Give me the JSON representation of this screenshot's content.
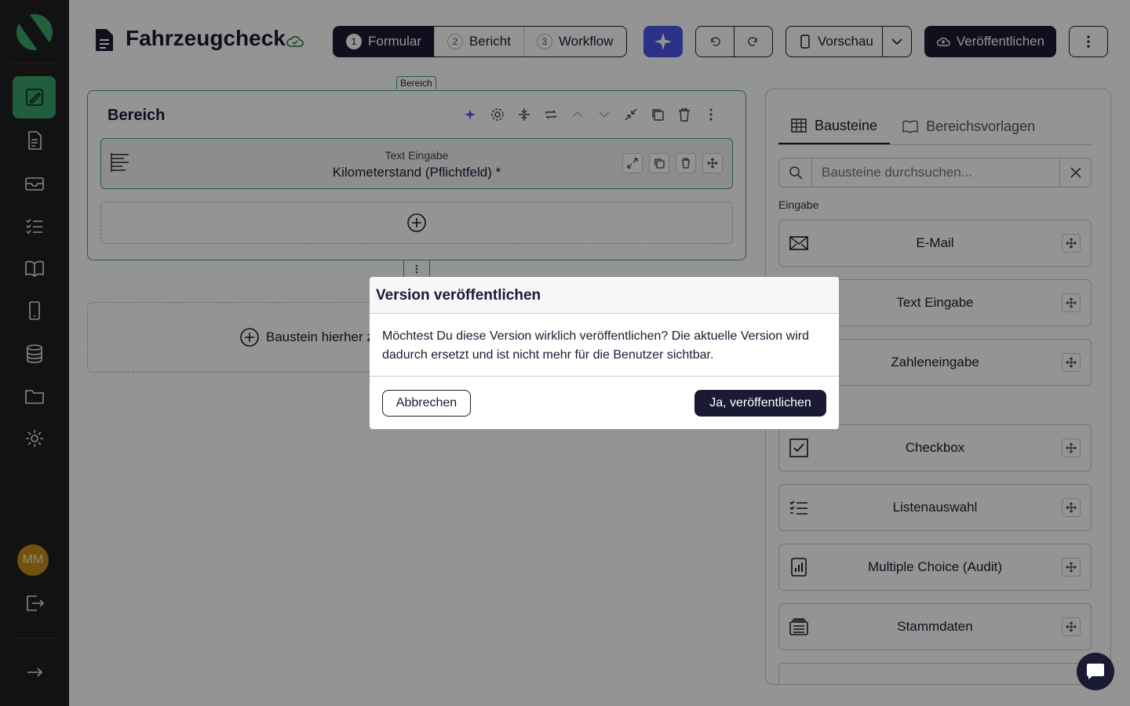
{
  "nav": {
    "avatar_initials": "MM",
    "accent_color": "#39a36a"
  },
  "header": {
    "title": "Fahrzeugcheck",
    "steps": [
      {
        "num": "1",
        "label": "Formular"
      },
      {
        "num": "2",
        "label": "Bericht"
      },
      {
        "num": "3",
        "label": "Workflow"
      }
    ],
    "preview_label": "Vorschau",
    "publish_label": "Veröffentlichen"
  },
  "editor": {
    "section_tag": "Bereich",
    "section_title": "Bereich",
    "field_type": "Text Eingabe",
    "field_name": "Kilometerstand (Pflichtfeld) *",
    "dropzone_label": "Baustein hierher zie"
  },
  "panel": {
    "tabs": [
      {
        "label": "Bausteine"
      },
      {
        "label": "Bereichsvorlagen"
      }
    ],
    "search_placeholder": "Bausteine durchsuchen...",
    "group_label": "Eingabe",
    "blocks": [
      {
        "label": "E-Mail",
        "icon": "envelope-icon"
      },
      {
        "label": "Text Eingabe",
        "icon": "text-icon"
      },
      {
        "label": "Zahleneingabe",
        "icon": "number-icon"
      },
      {
        "label": "Checkbox",
        "icon": "checkbox-icon"
      },
      {
        "label": "Listenauswahl",
        "icon": "list-icon"
      },
      {
        "label": "Multiple Choice (Audit)",
        "icon": "chart-icon"
      },
      {
        "label": "Stammdaten",
        "icon": "database-icon"
      }
    ]
  },
  "modal": {
    "title": "Version veröffentlichen",
    "body": "Möchtest Du diese Version wirklich veröffentlichen? Die aktuelle Version wird dadurch ersetzt und ist nicht mehr für die Benutzer sichtbar.",
    "cancel_label": "Abbrechen",
    "confirm_label": "Ja, veröffentlichen"
  }
}
